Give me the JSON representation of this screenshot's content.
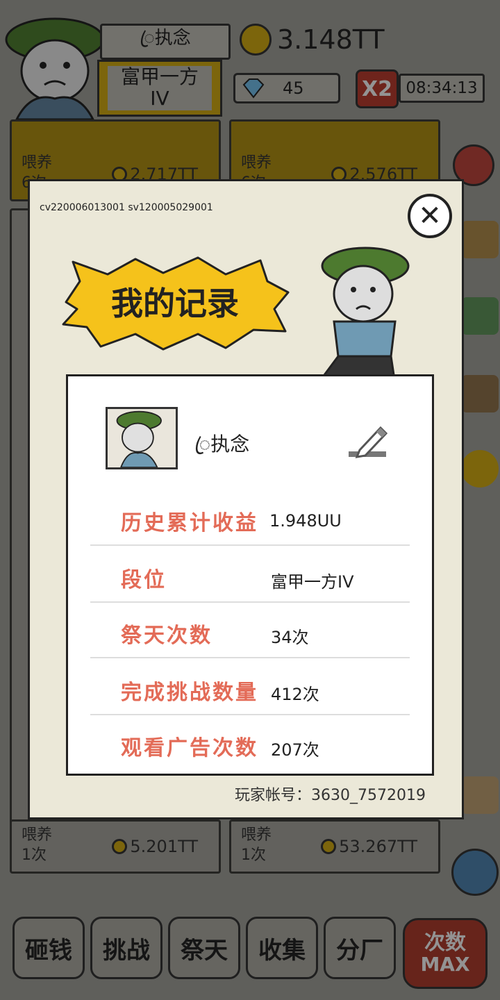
{
  "header": {
    "player_name": "ꦿ执念",
    "rank_line1": "富甲一方",
    "rank_line2": "IV",
    "gold": "3.148TT",
    "diamonds": "45",
    "multiplier": "X2",
    "timer": "08:34:13"
  },
  "background_cards": [
    {
      "label": "喂养\n6次",
      "value": "2.717TT"
    },
    {
      "label": "喂养\n6次",
      "value": "2.576TT"
    },
    {
      "label": "喂养\n1次",
      "value": "5.201TT"
    },
    {
      "label": "喂养\n1次",
      "value": "53.267TT"
    }
  ],
  "bottom_nav": [
    "砸钱",
    "挑战",
    "祭天",
    "收集",
    "分厂"
  ],
  "max_button": {
    "line1": "次数",
    "line2": "MAX"
  },
  "dialog": {
    "version": "cv220006013001 sv120005029001",
    "title": "我的记录",
    "close_label": "✕",
    "profile_name": "ꦿ执念",
    "stats": [
      {
        "label": "历史累计收益",
        "value": "1.948UU"
      },
      {
        "label": "段位",
        "value": "富甲一方IV"
      },
      {
        "label": "祭天次数",
        "value": "34次"
      },
      {
        "label": "完成挑战数量",
        "value": "412次"
      },
      {
        "label": "观看广告次数",
        "value": "207次"
      }
    ],
    "account": "玩家帐号：3630_7572019"
  },
  "colors": {
    "accent": "#e36b57",
    "gold": "#c9a414",
    "banner": "#f5c21b"
  }
}
